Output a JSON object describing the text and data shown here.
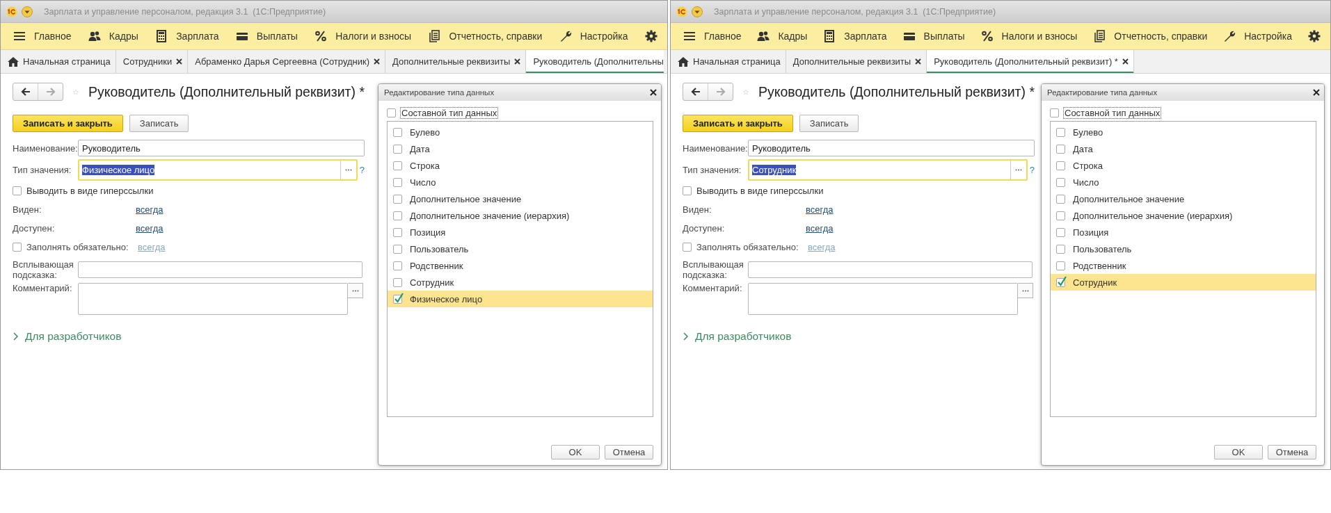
{
  "windows": [
    {
      "title_bar": {
        "title": "Зарплата и управление персоналом, редакция 3.1  (1С:Предприятие)"
      },
      "menu": [
        {
          "label": "Главное"
        },
        {
          "label": "Кадры"
        },
        {
          "label": "Зарплата"
        },
        {
          "label": "Выплаты"
        },
        {
          "label": "Налоги и взносы"
        },
        {
          "label": "Отчетность, справки"
        },
        {
          "label": "Настройка"
        }
      ],
      "tabs": [
        {
          "kind": "home",
          "label": "Начальная страница",
          "selected": false
        },
        {
          "kind": "page",
          "label": "Сотрудники",
          "selected": false
        },
        {
          "kind": "page",
          "label": "Абраменко Дарья Сергеевна (Сотрудник)",
          "selected": false
        },
        {
          "kind": "page",
          "label": "Дополнительные реквизиты",
          "selected": false
        },
        {
          "kind": "cut",
          "label": "Руководитель (Дополнительны",
          "selected": true
        }
      ],
      "form": {
        "history": {
          "back_enabled": true,
          "forward_enabled": false
        },
        "favorite": false,
        "title": "Руководитель (Дополнительный реквизит) *",
        "buttons": [
          {
            "label": "Записать и закрыть",
            "primary": true
          },
          {
            "label": "Записать",
            "primary": false
          }
        ],
        "rows": [
          {
            "kind": "text",
            "label": "Наименование:",
            "value": "Руководитель"
          },
          {
            "kind": "choice",
            "label": "Тип значения:",
            "value": "Физическое лицо",
            "value_selected": true,
            "help": "?"
          },
          {
            "kind": "checkbox",
            "label": "Выводить в виде гиперссылки",
            "checked": false
          },
          {
            "kind": "link",
            "label": "Виден:",
            "link": "всегда",
            "link_disabled": false
          },
          {
            "kind": "link",
            "label": "Доступен:",
            "link": "всегда",
            "link_disabled": false
          },
          {
            "kind": "checkbox_link",
            "label": "Заполнять обязательно:",
            "checked": false,
            "link": "всегда",
            "link_disabled": true
          },
          {
            "kind": "text",
            "label": "Всплывающая подсказка:"
          },
          {
            "kind": "memo",
            "label": "Комментарий:"
          }
        ],
        "section": {
          "label": "Для разработчиков",
          "expanded": false
        }
      },
      "dialog": {
        "title": "Редактирование типа данных",
        "composite": {
          "label": "Составной тип данных",
          "checked": false
        },
        "types": [
          {
            "label": "Булево",
            "checked": false,
            "selected": false
          },
          {
            "label": "Дата",
            "checked": false,
            "selected": false
          },
          {
            "label": "Строка",
            "checked": false,
            "selected": false
          },
          {
            "label": "Число",
            "checked": false,
            "selected": false
          },
          {
            "label": "Дополнительное значение",
            "checked": false,
            "selected": false
          },
          {
            "label": "Дополнительное значение (иерархия)",
            "checked": false,
            "selected": false
          },
          {
            "label": "Позиция",
            "checked": false,
            "selected": false
          },
          {
            "label": "Пользователь",
            "checked": false,
            "selected": false
          },
          {
            "label": "Родственник",
            "checked": false,
            "selected": false
          },
          {
            "label": "Сотрудник",
            "checked": false,
            "selected": false
          },
          {
            "label": "Физическое лицо",
            "checked": true,
            "selected": true
          }
        ],
        "buttons": [
          "OK",
          "Отмена"
        ]
      }
    },
    {
      "title_bar": {
        "title": "Зарплата и управление персоналом, редакция 3.1  (1С:Предприятие)"
      },
      "menu": [
        {
          "label": "Главное"
        },
        {
          "label": "Кадры"
        },
        {
          "label": "Зарплата"
        },
        {
          "label": "Выплаты"
        },
        {
          "label": "Налоги и взносы"
        },
        {
          "label": "Отчетность, справки"
        },
        {
          "label": "Настройка"
        }
      ],
      "tabs": [
        {
          "kind": "home",
          "label": "Начальная страница",
          "selected": false
        },
        {
          "kind": "page",
          "label": "Дополнительные реквизиты",
          "selected": false
        },
        {
          "kind": "page",
          "label": "Руководитель (Дополнительный реквизит) *",
          "selected": true
        }
      ],
      "form": {
        "history": {
          "back_enabled": true,
          "forward_enabled": false
        },
        "favorite": false,
        "title": "Руководитель (Дополнительный реквизит) *",
        "buttons": [
          {
            "label": "Записать и закрыть",
            "primary": true
          },
          {
            "label": "Записать",
            "primary": false
          }
        ],
        "rows": [
          {
            "kind": "text",
            "label": "Наименование:",
            "value": "Руководитель"
          },
          {
            "kind": "choice",
            "label": "Тип значения:",
            "value": "Сотрудник",
            "value_selected": true,
            "help": "?"
          },
          {
            "kind": "checkbox",
            "label": "Выводить в виде гиперссылки",
            "checked": false
          },
          {
            "kind": "link",
            "label": "Виден:",
            "link": "всегда",
            "link_disabled": false
          },
          {
            "kind": "link",
            "label": "Доступен:",
            "link": "всегда",
            "link_disabled": false
          },
          {
            "kind": "checkbox_link",
            "label": "Заполнять обязательно:",
            "checked": false,
            "link": "всегда",
            "link_disabled": true
          },
          {
            "kind": "text",
            "label": "Всплывающая подсказка:"
          },
          {
            "kind": "memo",
            "label": "Комментарий:"
          }
        ],
        "section": {
          "label": "Для разработчиков",
          "expanded": false
        }
      },
      "dialog": {
        "title": "Редактирование типа данных",
        "composite": {
          "label": "Составной тип данных",
          "checked": false
        },
        "types": [
          {
            "label": "Булево",
            "checked": false,
            "selected": false
          },
          {
            "label": "Дата",
            "checked": false,
            "selected": false
          },
          {
            "label": "Строка",
            "checked": false,
            "selected": false
          },
          {
            "label": "Число",
            "checked": false,
            "selected": false
          },
          {
            "label": "Дополнительное значение",
            "checked": false,
            "selected": false
          },
          {
            "label": "Дополнительное значение (иерархия)",
            "checked": false,
            "selected": false
          },
          {
            "label": "Позиция",
            "checked": false,
            "selected": false
          },
          {
            "label": "Пользователь",
            "checked": false,
            "selected": false
          },
          {
            "label": "Родственник",
            "checked": false,
            "selected": false
          },
          {
            "label": "Сотрудник",
            "checked": true,
            "selected": true
          }
        ],
        "buttons": [
          "OK",
          "Отмена"
        ]
      }
    }
  ]
}
